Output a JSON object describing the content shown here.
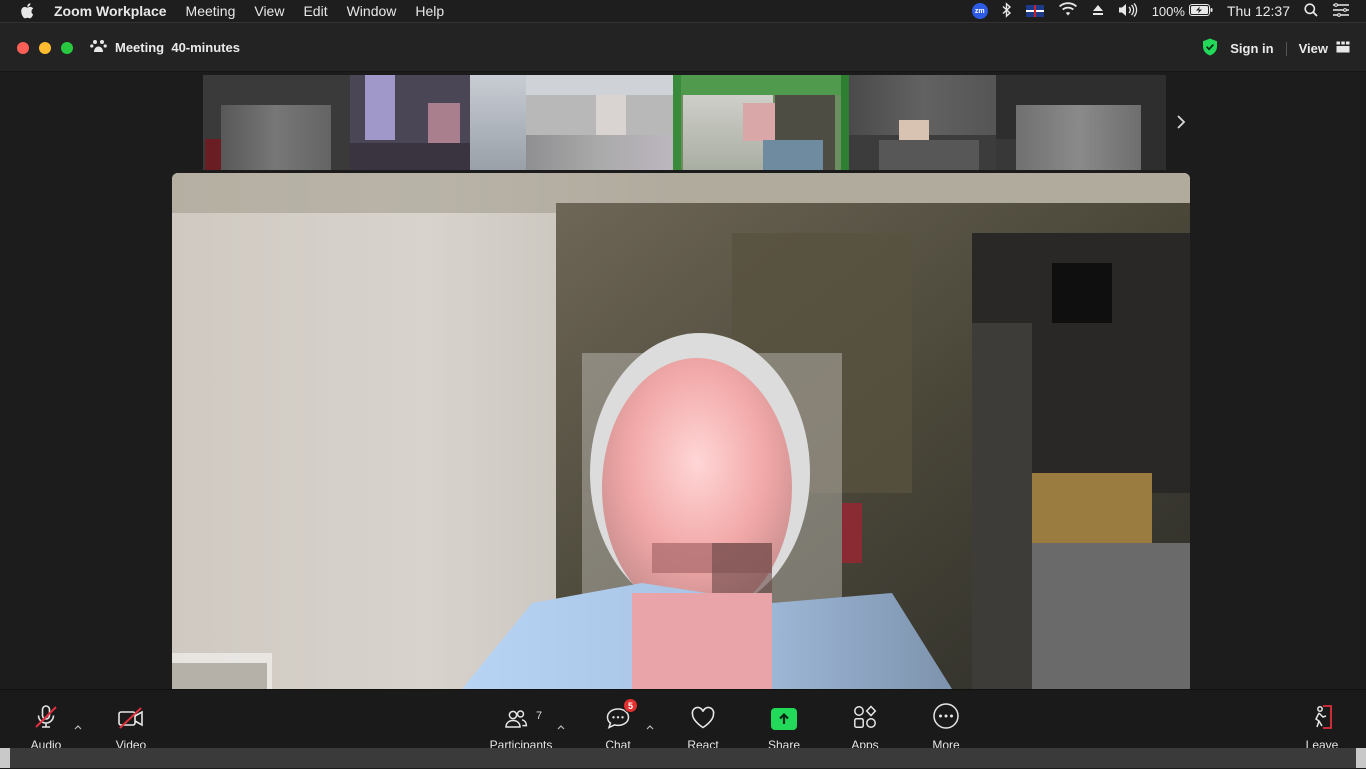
{
  "menubar": {
    "app_name": "Zoom Workplace",
    "menus": [
      "Meeting",
      "View",
      "Edit",
      "Window",
      "Help"
    ],
    "zoom_badge": "zm",
    "battery_percent": "100%",
    "clock": "Thu 12:37",
    "icons": [
      "apple-icon",
      "zoom-status-icon",
      "bluetooth-icon",
      "uk-flag-icon",
      "wifi-icon",
      "eject-icon",
      "volume-icon",
      "battery-charging-icon",
      "spotlight-search-icon",
      "control-center-icon"
    ]
  },
  "titlebar": {
    "meeting_title": "Meeting  40-minutes",
    "sign_in": "Sign in",
    "view": "View",
    "accent_shield": "#23d959"
  },
  "gallery": {
    "next_icon": "chevron-right-icon"
  },
  "toolbar": {
    "audio": "Audio",
    "video": "Video",
    "participants": "Participants",
    "participants_count": "7",
    "chat": "Chat",
    "chat_badge": "5",
    "react": "React",
    "share": "Share",
    "apps": "Apps",
    "more": "More",
    "leave": "Leave",
    "share_color": "#23d959",
    "muted_color": "#e0303c"
  }
}
